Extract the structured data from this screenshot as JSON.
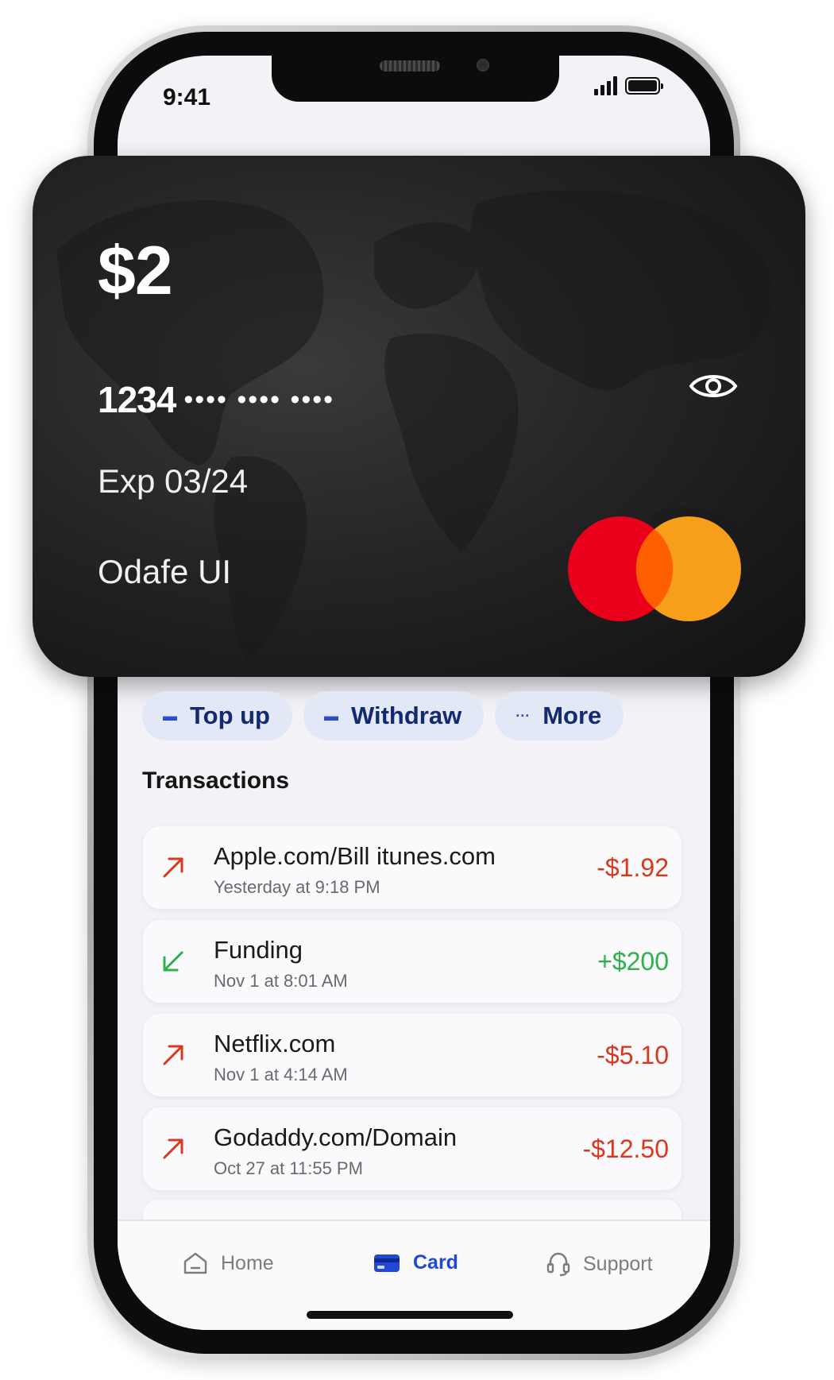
{
  "status_bar": {
    "time": "9:41"
  },
  "card": {
    "balance": "$2",
    "number_first": "1234",
    "number_masked": "•••• •••• ••••",
    "expiry": "Exp 03/24",
    "holder": "Odafe UI",
    "brand_colors": {
      "red": "#eb001b",
      "orange": "#f79e1b",
      "overlap": "#ff5f00"
    }
  },
  "actions": [
    {
      "label": "Top up",
      "icon": "card-icon"
    },
    {
      "label": "Withdraw",
      "icon": "card-icon"
    },
    {
      "label": "More",
      "icon": "more-icon"
    }
  ],
  "transactions_heading": "Transactions",
  "transactions": [
    {
      "name": "Apple.com/Bill itunes.com",
      "date": "Yesterday at 9:18 PM",
      "amount": "-$1.92",
      "direction": "out",
      "color": "#d9381e"
    },
    {
      "name": "Funding",
      "date": "Nov 1 at 8:01 AM",
      "amount": "+$200",
      "direction": "in",
      "color": "#2bb24c"
    },
    {
      "name": "Netflix.com",
      "date": "Nov 1 at 4:14 AM",
      "amount": "-$5.10",
      "direction": "out",
      "color": "#d9381e"
    },
    {
      "name": "Godaddy.com/Domain",
      "date": "Oct 27 at 11:55 PM",
      "amount": "-$12.50",
      "direction": "out",
      "color": "#d9381e"
    }
  ],
  "nav": {
    "home": "Home",
    "card": "Card",
    "support": "Support"
  },
  "colors": {
    "accent": "#2147d4",
    "action_bg": "#e3e8f6",
    "action_text": "#142a70"
  }
}
